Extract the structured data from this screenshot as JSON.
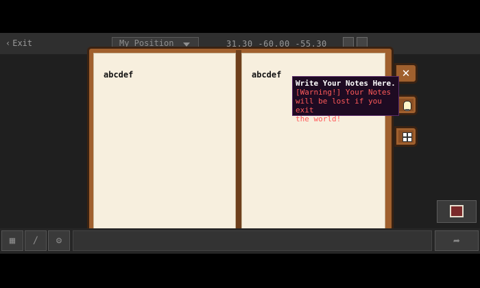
{
  "topbar": {
    "exit_label": "Exit",
    "position_select": "My Position",
    "coordinates": "31.30 -60.00 -55.30"
  },
  "notebook": {
    "left_page_text": "abcdef",
    "right_page_text": "abcdef"
  },
  "tooltip": {
    "title": "Write Your Notes Here.",
    "warning_lines": [
      "[Warning!] Your Notes",
      "will be lost if you exit",
      "the world!"
    ]
  },
  "icons": {
    "close": "close-icon",
    "hint": "lightbulb-icon",
    "grid": "grid-icon",
    "book": "book-icon",
    "send": "send-icon"
  },
  "colors": {
    "book_frame": "#a0602e",
    "page": "#f7efde",
    "tooltip_bg": "#1e0b22",
    "warning_text": "#ff5a5a"
  }
}
